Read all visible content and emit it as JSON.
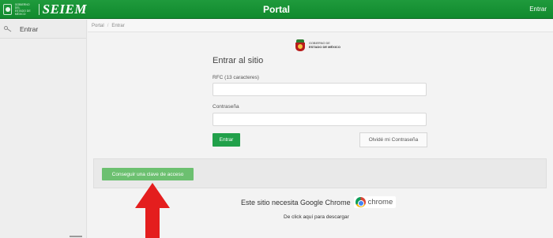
{
  "header": {
    "logo_gov_lines": [
      "GOBIERNO DEL",
      "ESTADO DE MÉXICO"
    ],
    "logo_brand": "SEIEM",
    "title": "Portal",
    "login_link": "Entrar"
  },
  "sidebar": {
    "items": [
      {
        "label": "Entrar",
        "icon": "key-icon"
      }
    ]
  },
  "breadcrumb": {
    "items": [
      "Portal",
      "Entrar"
    ],
    "separator": "/"
  },
  "gov_logo": {
    "line1": "GOBIERNO DE",
    "line2": "ESTADO DE MÉXICO"
  },
  "login": {
    "title": "Entrar al sitio",
    "rfc_label": "RFC (13 caracteres)",
    "rfc_value": "",
    "password_label": "Contraseña",
    "password_value": "",
    "submit_label": "Entrar",
    "forgot_label": "Olvidé mi Contraseña"
  },
  "access_panel": {
    "button_label": "Conseguir una clave de acceso"
  },
  "browser_notice": {
    "message": "Este sitio necesita Google Chrome",
    "chrome_word": "chrome",
    "download_text": "De click aquí para descargar"
  },
  "colors": {
    "header_green": "#1f9a3c",
    "button_green": "#21a04a",
    "light_button_green": "#6cc070",
    "annotation_red": "#e41e1e"
  }
}
